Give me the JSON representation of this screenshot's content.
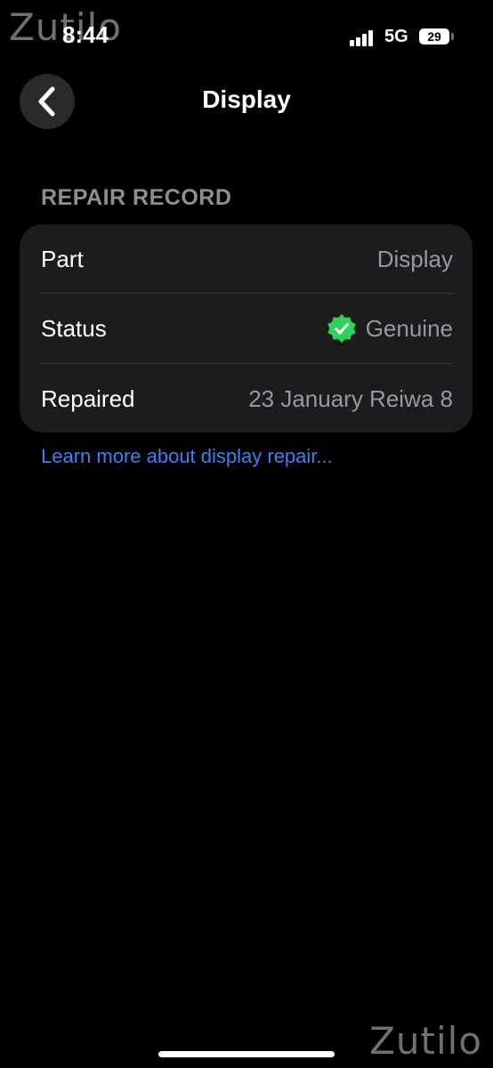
{
  "watermark": "Zutilo",
  "status_bar": {
    "time": "8:44",
    "network": "5G",
    "battery": "29"
  },
  "nav": {
    "back_icon": "chevron-left-icon",
    "title": "Display"
  },
  "section": {
    "header": "REPAIR RECORD"
  },
  "rows": [
    {
      "label": "Part",
      "value": "Display"
    },
    {
      "label": "Status",
      "value": "Genuine",
      "icon": "verified-check-icon",
      "icon_color": "#30d158"
    },
    {
      "label": "Repaired",
      "value": "23 January Reiwa 8"
    }
  ],
  "link": {
    "text": "Learn more about display repair..."
  },
  "colors": {
    "background": "#000000",
    "card": "#1c1c1e",
    "link": "#3a82f7",
    "secondary_text": "#98989e",
    "section_header": "#8e8e93"
  }
}
